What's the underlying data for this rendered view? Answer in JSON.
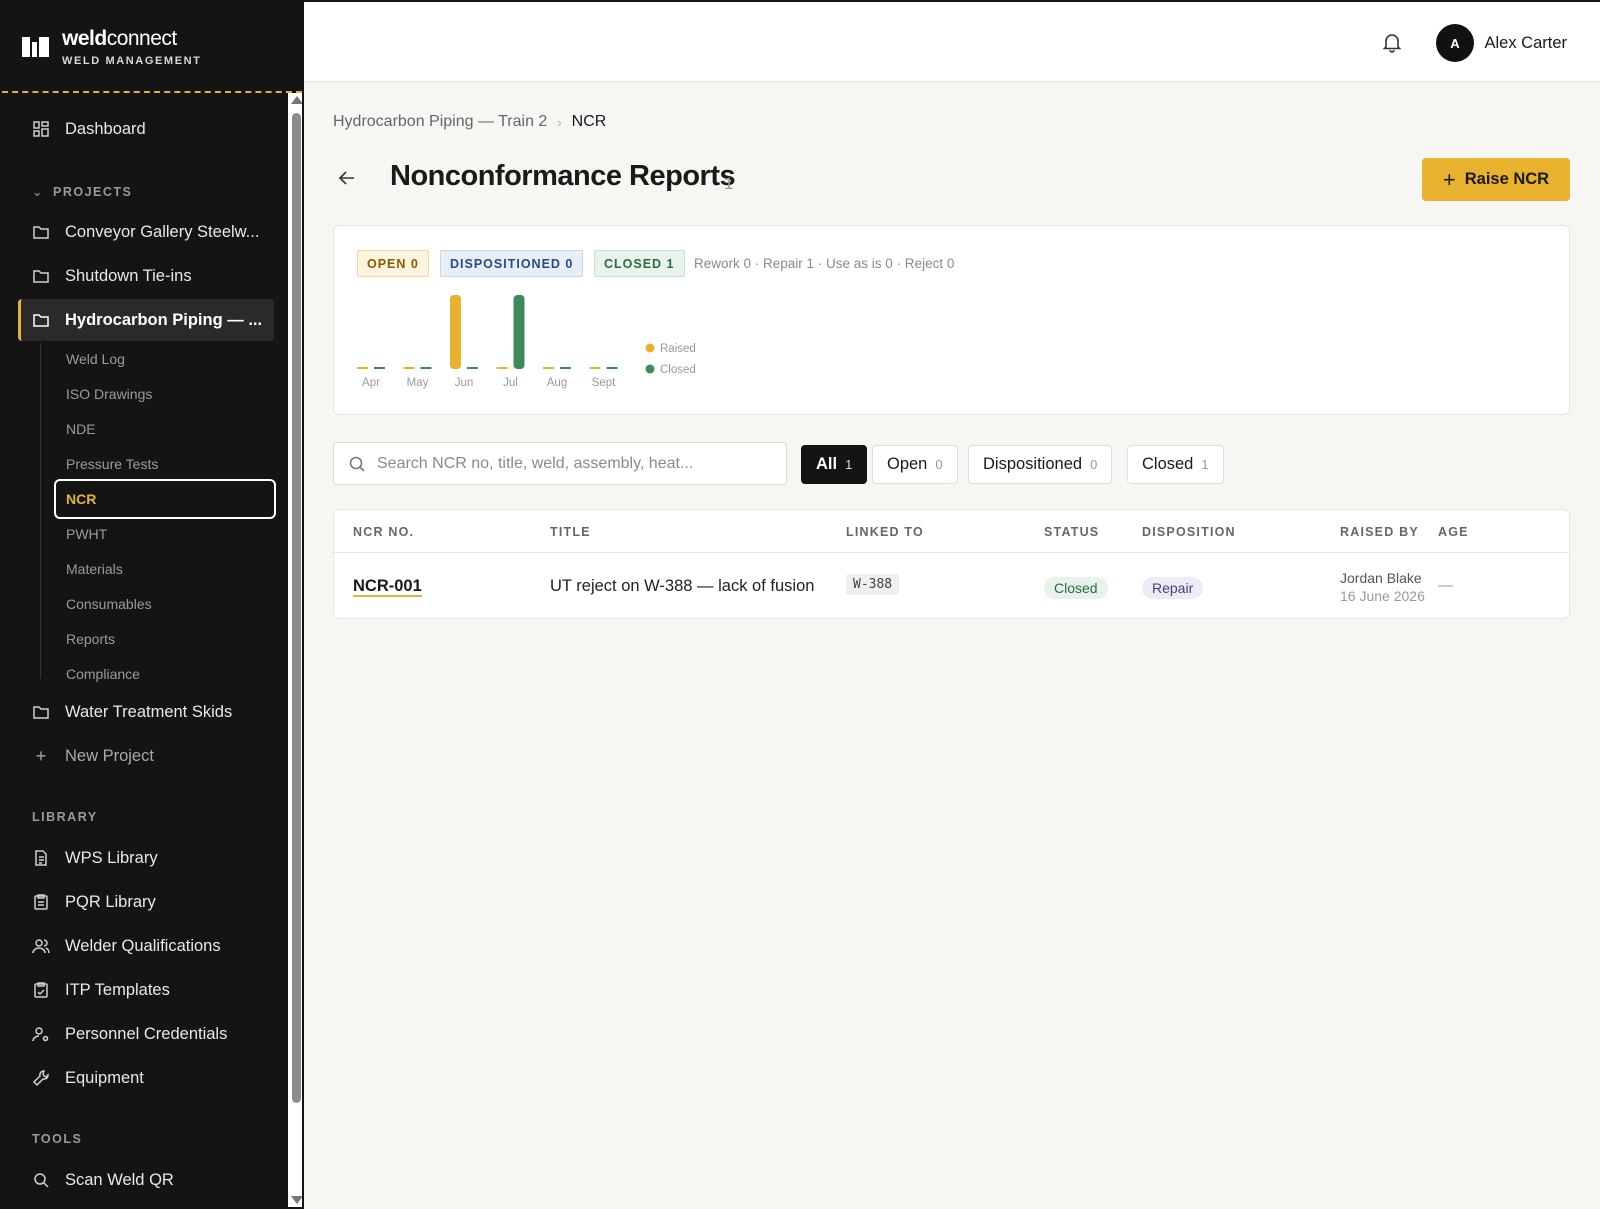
{
  "brand": {
    "name_bold": "weld",
    "name_light": "connect",
    "subtitle": "WELD MANAGEMENT"
  },
  "sidebar": {
    "dashboard": "Dashboard",
    "projects_label": "PROJECTS",
    "projects": [
      "Conveyor Gallery Steelw...",
      "Shutdown Tie-ins",
      "Hydrocarbon Piping — ...",
      "Water Treatment Skids"
    ],
    "sub_items": [
      "Weld Log",
      "ISO Drawings",
      "NDE",
      "Pressure Tests",
      "NCR",
      "PWHT",
      "Materials",
      "Consumables",
      "Reports",
      "Compliance"
    ],
    "new_project": "New Project",
    "library_label": "LIBRARY",
    "library": [
      "WPS Library",
      "PQR Library",
      "Welder Qualifications",
      "ITP Templates",
      "Personnel Credentials",
      "Equipment"
    ],
    "tools_label": "TOOLS",
    "tools": [
      "Scan Weld QR"
    ]
  },
  "topbar": {
    "avatar_initial": "A",
    "user_name": "Alex Carter"
  },
  "breadcrumb": {
    "parent": "Hydrocarbon Piping — Train 2",
    "separator": "›",
    "current": "NCR"
  },
  "page": {
    "title": "Nonconformance Reports",
    "count": "1",
    "raise_button": "Raise NCR",
    "raise_plus": "+"
  },
  "summary": {
    "open": "OPEN 0",
    "dispositioned": "DISPOSITIONED 0",
    "closed": "CLOSED 1",
    "dispositions": "Rework 0 · Repair 1 · Use as is 0 · Reject 0"
  },
  "chart_data": {
    "type": "bar",
    "categories": [
      "Apr",
      "May",
      "Jun",
      "Jul",
      "Aug",
      "Sept"
    ],
    "series": [
      {
        "name": "Raised",
        "values": [
          0,
          0,
          1,
          0,
          0,
          0
        ],
        "color": "#e8b22e"
      },
      {
        "name": "Closed",
        "values": [
          0,
          0,
          0,
          1,
          0,
          0
        ],
        "color": "#3f8a5a"
      }
    ],
    "legend": "right",
    "grid": false
  },
  "search": {
    "placeholder": "Search NCR no, title, weld, assembly, heat..."
  },
  "filters": [
    {
      "label": "All",
      "count": "1"
    },
    {
      "label": "Open",
      "count": "0"
    },
    {
      "label": "Dispositioned",
      "count": "0"
    },
    {
      "label": "Closed",
      "count": "1"
    }
  ],
  "table": {
    "headers": [
      "NCR NO.",
      "TITLE",
      "LINKED TO",
      "STATUS",
      "DISPOSITION",
      "RAISED BY",
      "AGE"
    ],
    "rows": [
      {
        "ncr_no": "NCR-001",
        "title": "UT reject on W-388 — lack of fusion",
        "linked_to": "W-388",
        "status": "Closed",
        "disposition": "Repair",
        "raised_by": "Jordan Blake",
        "raised_date": "16 June 2026",
        "age": "—"
      }
    ]
  }
}
